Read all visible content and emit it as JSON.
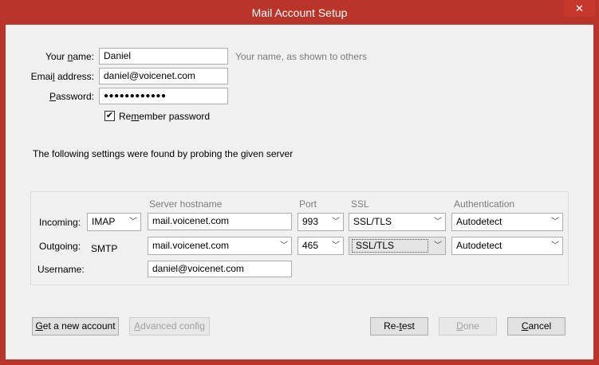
{
  "window": {
    "title": "Mail Account Setup",
    "close_glyph": "✕"
  },
  "identity": {
    "name_label": "Your name:",
    "name_value": "Daniel",
    "name_hint": "Your name, as shown to others",
    "email_label": "Email address:",
    "email_value": "daniel@voicenet.com",
    "password_label": "Password:",
    "password_value": "●●●●●●●●●●●●",
    "remember_label": "Remember password",
    "remember_checked": true
  },
  "probe_message": "The following settings were found by probing the given server",
  "server": {
    "headers": {
      "hostname": "Server hostname",
      "port": "Port",
      "ssl": "SSL",
      "auth": "Authentication"
    },
    "incoming": {
      "label": "Incoming:",
      "protocol": "IMAP",
      "hostname": "mail.voicenet.com",
      "port": "993",
      "ssl": "SSL/TLS",
      "auth": "Autodetect"
    },
    "outgoing": {
      "label": "Outgoing:",
      "protocol": "SMTP",
      "hostname": "mail.voicenet.com",
      "port": "465",
      "ssl": "SSL/TLS",
      "auth": "Autodetect"
    },
    "username": {
      "label": "Username:",
      "value": "daniel@voicenet.com"
    }
  },
  "buttons": {
    "get_account": "Get a new account",
    "advanced": "Advanced config",
    "retest": "Re-test",
    "done": "Done",
    "cancel": "Cancel"
  },
  "colors": {
    "titlebar": "#b93529",
    "client_bg": "#f0f0f0",
    "hint_text": "#7a7a7a"
  }
}
